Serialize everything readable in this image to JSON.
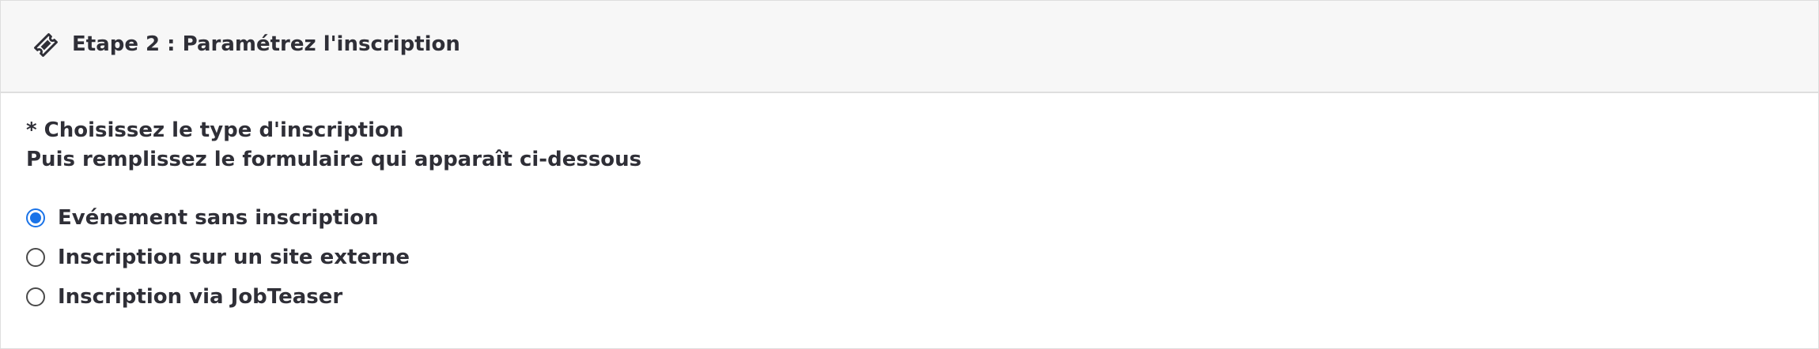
{
  "header": {
    "icon": "ticket-icon",
    "title": "Etape 2 : Paramétrez l'inscription"
  },
  "instructions": {
    "line1": "* Choisissez le type d'inscription",
    "line2": "Puis remplissez le formulaire qui apparaît ci-dessous"
  },
  "registration_options": [
    {
      "label": "Evénement sans inscription",
      "selected": true
    },
    {
      "label": "Inscription sur un site externe",
      "selected": false
    },
    {
      "label": "Inscription via JobTeaser",
      "selected": false
    }
  ],
  "colors": {
    "accent": "#1a73e8",
    "header_bg": "#f7f7f7",
    "text": "#2f2f37",
    "border": "#dedede"
  }
}
